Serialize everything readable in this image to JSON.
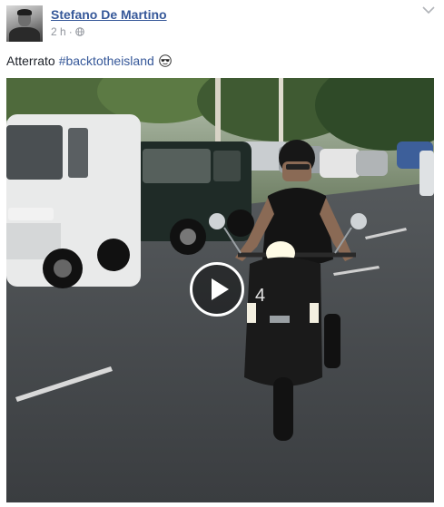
{
  "post": {
    "author_name": "Stefano De Martino",
    "timestamp": "2 h",
    "separator": "·",
    "privacy_icon": "globe-icon",
    "menu_icon": "chevron-down-icon",
    "text": "Atterrato",
    "hashtag": "#backtotheisland",
    "emoji": "sunglasses-emoji-icon"
  },
  "video": {
    "play_icon": "play-icon",
    "scooter_plate": "4"
  },
  "colors": {
    "link": "#365899",
    "meta": "#90949c",
    "text": "#1d2129"
  }
}
